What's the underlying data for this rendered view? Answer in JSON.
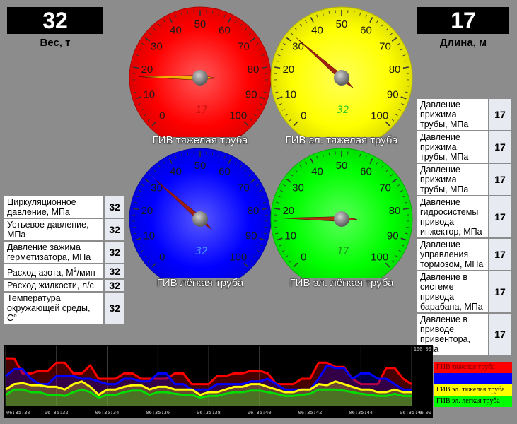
{
  "weight": {
    "value": "32",
    "label": "Вес, т"
  },
  "length": {
    "value": "17",
    "label": "Длина, м"
  },
  "gauges": [
    {
      "id": "heavy",
      "title": "ГИВ тяжелая труба",
      "color": "#ff0000",
      "value": 17,
      "digital": "17",
      "digital_color": "#cc1010"
    },
    {
      "id": "el-heavy",
      "title": "ГИВ эл. тяжелая труба",
      "color": "#ffff00",
      "value": 32,
      "digital": "32",
      "digital_color": "#3cc81e"
    },
    {
      "id": "light",
      "title": "ГИВ лёгкая труба",
      "color": "#0000ff",
      "value": 32,
      "digital": "32",
      "digital_color": "#4a8cff"
    },
    {
      "id": "el-light",
      "title": "ГИВ эл. лёгкая труба",
      "color": "#00ff00",
      "value": 17,
      "digital": "17",
      "digital_color": "#1a9a1a"
    }
  ],
  "gauge_ticks": [
    "0",
    "10",
    "20",
    "30",
    "40",
    "50",
    "60",
    "70",
    "80",
    "90",
    "100"
  ],
  "left_params": [
    {
      "label": "Циркуляционное давление, МПа",
      "value": "32"
    },
    {
      "label": "Устьевое давление, МПа",
      "value": "32"
    },
    {
      "label": "Давление зажима герметизатора, МПа",
      "value": "32"
    },
    {
      "label_pre": "Расход азота, М",
      "label_sup": "2",
      "label_post": "/мин",
      "value": "32"
    },
    {
      "label": "Расход жидкости, л/с",
      "value": "32"
    },
    {
      "label": "Температура окружающей среды, С°",
      "value": "32"
    }
  ],
  "right_params": [
    {
      "label": "Давление прижима трубы, МПа",
      "value": "17"
    },
    {
      "label": "Давление прижима трубы, МПа",
      "value": "17"
    },
    {
      "label": "Давление прижима трубы, МПа",
      "value": "17"
    },
    {
      "label": "Давление гидросистемы привода инжектор, МПа",
      "value": "17"
    },
    {
      "label": "Давление управления тормозом, МПа",
      "value": "17"
    },
    {
      "label": "Давление в системе привода барабана, МПа",
      "value": "17"
    },
    {
      "label": "Давление в приводе привентора, МПа",
      "value": "17"
    }
  ],
  "chart_data": {
    "type": "line",
    "ylim": [
      0,
      100
    ],
    "y_tick_labels": [
      "100.00",
      "0.00"
    ],
    "x": [
      "06:35:30",
      "06:35:32",
      "06:35:34",
      "06:35:36",
      "06:35:38",
      "06:35:40",
      "06:35:42",
      "06:35:44",
      "06:35:46"
    ],
    "series": [
      {
        "name": "ГИВ тяжелая труба",
        "color": "#ff0000",
        "values": [
          88,
          88,
          60,
          60,
          65,
          65,
          80,
          80,
          60,
          60,
          75,
          50,
          50,
          50,
          60,
          60,
          50,
          50,
          50,
          50,
          60,
          60,
          40,
          40,
          40,
          55,
          55,
          60,
          60,
          65,
          65,
          60,
          40,
          40,
          40,
          50,
          50,
          80,
          80,
          72,
          72,
          50,
          40,
          40,
          40,
          70,
          70,
          50,
          40
        ]
      },
      {
        "name": "ГИВ лёгкая труба",
        "color": "#0000ff",
        "values": [
          55,
          68,
          68,
          50,
          40,
          40,
          55,
          55,
          55,
          50,
          50,
          45,
          40,
          40,
          50,
          50,
          45,
          45,
          60,
          60,
          40,
          40,
          30,
          30,
          30,
          40,
          40,
          40,
          40,
          45,
          45,
          50,
          40,
          30,
          30,
          30,
          30,
          50,
          75,
          70,
          70,
          50,
          60,
          60,
          50,
          50,
          40,
          30,
          30
        ]
      },
      {
        "name": "ГИВ эл. тяжелая труба",
        "color": "#ffff00",
        "values": [
          30,
          40,
          42,
          38,
          38,
          35,
          35,
          30,
          40,
          45,
          35,
          20,
          30,
          30,
          35,
          38,
          38,
          30,
          35,
          35,
          30,
          30,
          30,
          20,
          25,
          25,
          30,
          35,
          35,
          40,
          40,
          35,
          30,
          25,
          25,
          30,
          30,
          40,
          38,
          45,
          40,
          35,
          30,
          30,
          25,
          25,
          30,
          25,
          25
        ]
      },
      {
        "name": "ГИВ эл. легкая труба",
        "color": "#00dd00",
        "values": [
          20,
          30,
          30,
          25,
          25,
          20,
          20,
          18,
          25,
          30,
          25,
          15,
          20,
          20,
          25,
          28,
          28,
          20,
          25,
          25,
          22,
          20,
          20,
          15,
          18,
          18,
          22,
          25,
          25,
          28,
          28,
          25,
          22,
          18,
          18,
          20,
          22,
          30,
          30,
          30,
          28,
          25,
          22,
          20,
          18,
          18,
          22,
          18,
          18
        ]
      }
    ]
  }
}
